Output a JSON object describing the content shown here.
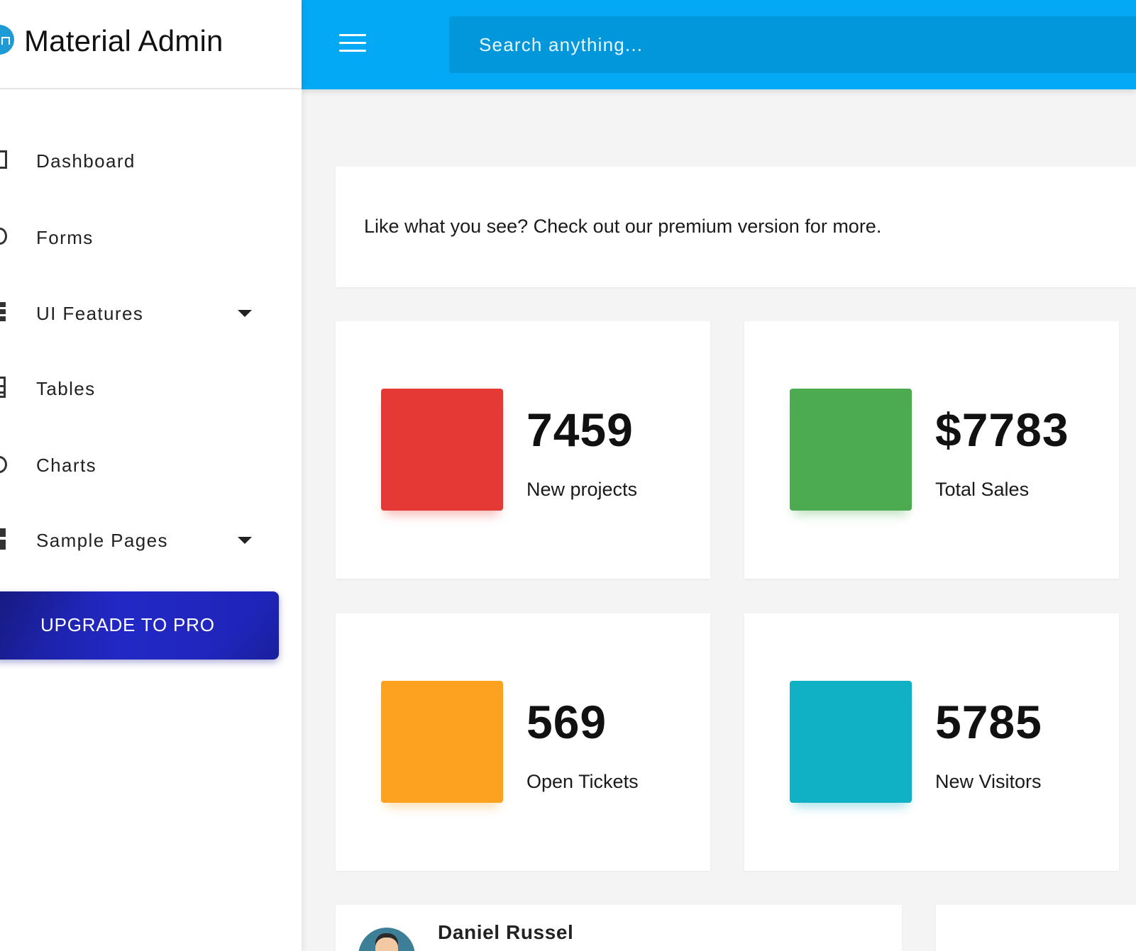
{
  "app": {
    "title": "Material Admin"
  },
  "topbar": {
    "search_placeholder": "Search anything..."
  },
  "sidebar": {
    "items": [
      {
        "label": "Dashboard",
        "icon": "dashboard-icon"
      },
      {
        "label": "Forms",
        "icon": "forms-icon"
      },
      {
        "label": "UI Features",
        "icon": "ui-features-icon",
        "expandable": true
      },
      {
        "label": "Tables",
        "icon": "tables-icon"
      },
      {
        "label": "Charts",
        "icon": "charts-icon"
      },
      {
        "label": "Sample Pages",
        "icon": "sample-pages-icon",
        "expandable": true
      }
    ],
    "upgrade_label": "UPGRADE TO PRO"
  },
  "banner": {
    "text": "Like what you see? Check out our premium version for more."
  },
  "stats": [
    {
      "value": "7459",
      "label": "New projects",
      "color": "#e53935"
    },
    {
      "value": "$7783",
      "label": "Total Sales",
      "color": "#4caa50"
    },
    {
      "value": "569",
      "label": "Open Tickets",
      "color": "#fca220"
    },
    {
      "value": "5785",
      "label": "New Visitors",
      "color": "#10b0c5"
    }
  ],
  "profile": {
    "name": "Daniel Russel"
  },
  "colors": {
    "topbar": "#03a9f4",
    "search": "#0297da",
    "upgrade": "#2228c4"
  }
}
